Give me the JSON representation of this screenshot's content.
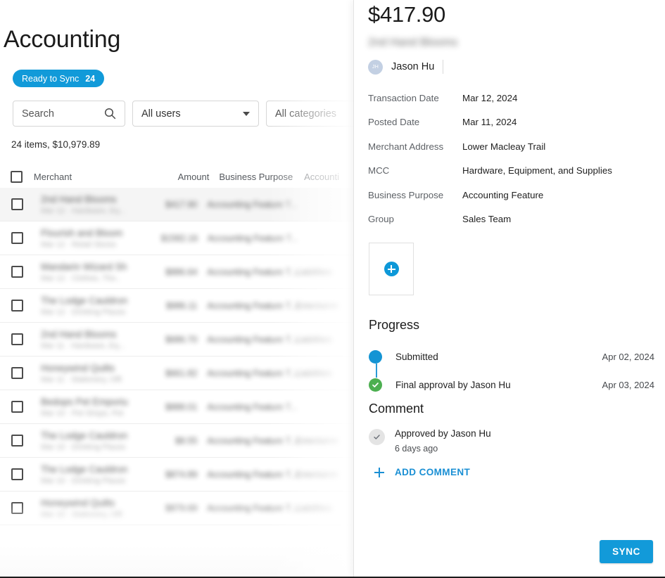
{
  "page": {
    "title": "Accounting",
    "status_pill": {
      "label": "Ready to Sync",
      "count": "24"
    },
    "items_summary": "24 items, $10,979.89"
  },
  "filters": {
    "search": {
      "placeholder": "Search",
      "value": "",
      "icon": "search-icon"
    },
    "users_select": {
      "value": "All users"
    },
    "categories_select": {
      "value": "All categories"
    }
  },
  "table": {
    "columns": [
      "Merchant",
      "Amount",
      "Business Purpose",
      "Accounti"
    ],
    "rows": [
      {
        "merchant": "2nd Hand Blooms",
        "sub": "Mar 12 · Hardware, Eq...",
        "amount": "$417.90",
        "purpose": "Accounting Feature T...",
        "account": "",
        "selected": true
      },
      {
        "merchant": "Flourish and Bloom",
        "sub": "Mar 12 · Retail Stores",
        "amount": "$1582.16",
        "purpose": "Accounting Feature T...",
        "account": "",
        "selected": false
      },
      {
        "merchant": "Mandarin Wizard Sh",
        "sub": "Mar 12 · Clothes, Tho..",
        "amount": "$886.64",
        "purpose": "Accounting Feature T...",
        "account": "Liabilities",
        "selected": false
      },
      {
        "merchant": "The Lodge Cauldron",
        "sub": "Mar 12 · Drinking Places",
        "amount": "$986.11",
        "purpose": "Accounting Feature T...",
        "account": "Entertainm",
        "selected": false
      },
      {
        "merchant": "2nd Hand Blooms",
        "sub": "Mar 11 · Hardware, Eq...",
        "amount": "$686.70",
        "purpose": "Accounting Feature T...",
        "account": "Liabilities",
        "selected": false
      },
      {
        "merchant": "Honeywind Quilts",
        "sub": "Mar 11 · Stationery, Offi",
        "amount": "$661.82",
        "purpose": "Accounting Feature T...",
        "account": "Liabilities",
        "selected": false
      },
      {
        "merchant": "Bedops Pet Emporiu",
        "sub": "Mar 10 · Pet Shops, Pet",
        "amount": "$888.01",
        "purpose": "Accounting Feature T...",
        "account": "",
        "selected": false
      },
      {
        "merchant": "The Lodge Cauldron",
        "sub": "Mar 10 · Drinking Places",
        "amount": "$8.55",
        "purpose": "Accounting Feature T...",
        "account": "Entertainm",
        "selected": false
      },
      {
        "merchant": "The Lodge Cauldron",
        "sub": "Mar 10 · Drinking Places",
        "amount": "$874.89",
        "purpose": "Accounting Feature T...",
        "account": "Entertainm",
        "selected": false
      },
      {
        "merchant": "Honeywind Quilts",
        "sub": "Mar 10 · Stationery, Offi",
        "amount": "$879.69",
        "purpose": "Accounting Feature T...",
        "account": "Liabilities",
        "selected": false
      }
    ]
  },
  "detail": {
    "amount": "$417.90",
    "merchant_name": "2nd Hand Blooms",
    "owner": {
      "initials": "JH",
      "name": "Jason Hu"
    },
    "fields": [
      {
        "label": "Transaction Date",
        "value": "Mar 12, 2024"
      },
      {
        "label": "Posted Date",
        "value": "Mar 11, 2024"
      },
      {
        "label": "Merchant Address",
        "value": "Lower Macleay Trail"
      },
      {
        "label": "MCC",
        "value": "Hardware, Equipment, and Supplies"
      },
      {
        "label": "Business Purpose",
        "value": "Accounting Feature"
      },
      {
        "label": "Group",
        "value": "Sales Team"
      }
    ],
    "attachment": {
      "icon": "plus-circle-icon"
    },
    "progress": {
      "title": "Progress",
      "steps": [
        {
          "label": "Submitted",
          "date": "Apr 02, 2024",
          "state": "blue"
        },
        {
          "label": "Final approval by Jason Hu",
          "date": "Apr 03, 2024",
          "state": "green"
        }
      ]
    },
    "comment": {
      "title": "Comment",
      "entries": [
        {
          "text": "Approved by Jason Hu",
          "time": "6 days ago",
          "icon": "check-icon"
        }
      ],
      "add_label": "ADD COMMENT"
    },
    "footer": {
      "sync_label": "SYNC"
    }
  },
  "colors": {
    "accent_blue": "#129ad9",
    "progress_blue": "#1494d4",
    "progress_green": "#4caf50",
    "link_blue": "#1a8fd4",
    "avatar_bg": "#c3d0e3"
  }
}
